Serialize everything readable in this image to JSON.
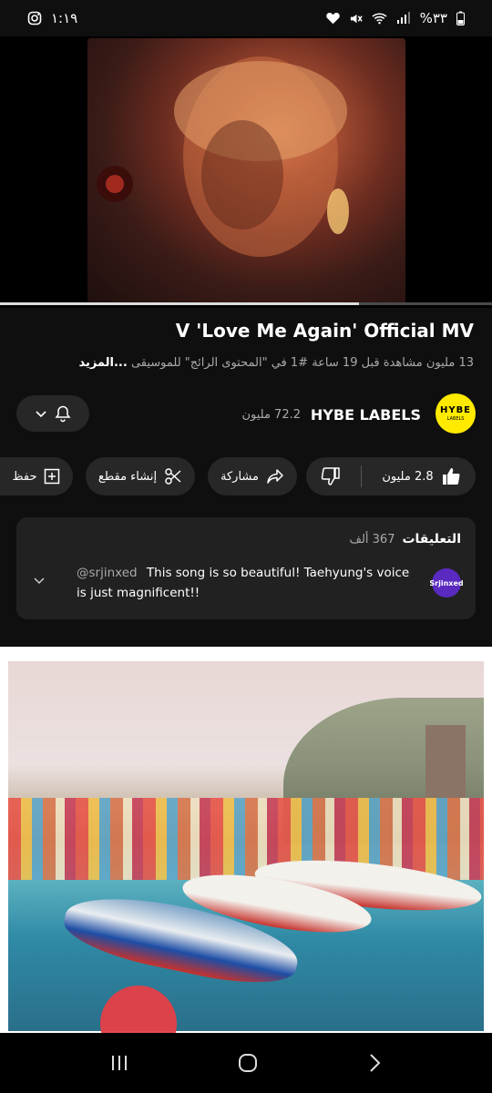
{
  "status_bar": {
    "time": "١:١٩",
    "battery": "%٣٣"
  },
  "video": {
    "title": "V 'Love Me Again' Official MV",
    "progress_fraction": 0.73,
    "meta": "13 مليون مشاهدة  قبل 19 ساعة  #1 في \"المحتوى الرائج\" للموسيقى",
    "more_label": "...المزيد"
  },
  "channel": {
    "name": "HYBE LABELS",
    "subscribers": "72.2 مليون",
    "avatar_text": "HYBE",
    "avatar_subtext": "LABELS"
  },
  "actions": {
    "like_count": "2.8 مليون",
    "share_label": "مشاركة",
    "clip_label": "إنشاء مقطع",
    "save_label": "حفظ"
  },
  "comments": {
    "label": "التعليقات",
    "count": "367 ألف",
    "top_comment": {
      "avatar_text": "Srjinxed",
      "user": "@srjinxed",
      "text": "This song is so beautiful! Taehyung's voice is just magnificent!!"
    }
  },
  "colors": {
    "background": "#0f0f0f",
    "pill": "#272727",
    "card": "#212121",
    "accent_yellow": "#ffea00"
  }
}
